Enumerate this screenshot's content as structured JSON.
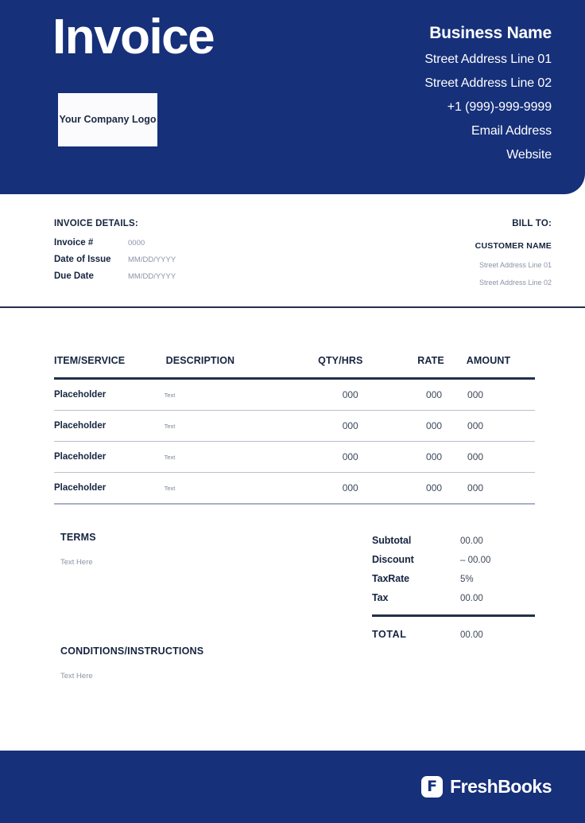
{
  "theme": {
    "brand_blue": "#16307a",
    "ink": "#16243f",
    "muted": "#8a93a6"
  },
  "header": {
    "title": "Invoice",
    "logo_placeholder": "Your Company Logo",
    "business": {
      "name": "Business Name",
      "lines": [
        "Street Address Line 01",
        "Street Address Line 02",
        "+1 (999)-999-9999",
        "Email Address",
        "Website"
      ]
    }
  },
  "invoice_details": {
    "title": "INVOICE DETAILS:",
    "rows": [
      {
        "label": "Invoice #",
        "value": "0000"
      },
      {
        "label": "Date of Issue",
        "value": "MM/DD/YYYY"
      },
      {
        "label": "Due Date",
        "value": "MM/DD/YYYY"
      }
    ]
  },
  "bill_to": {
    "title": "BILL TO:",
    "customer_name": "CUSTOMER NAME",
    "lines": [
      "Street Address Line 01",
      "Street Address Line 02"
    ]
  },
  "line_items": {
    "columns": [
      "ITEM/SERVICE",
      "DESCRIPTION",
      "QTY/HRS",
      "RATE",
      "AMOUNT"
    ],
    "rows": [
      {
        "item": "Placeholder",
        "description": "Text",
        "qty": "000",
        "rate": "000",
        "amount": "000"
      },
      {
        "item": "Placeholder",
        "description": "Text",
        "qty": "000",
        "rate": "000",
        "amount": "000"
      },
      {
        "item": "Placeholder",
        "description": "Text",
        "qty": "000",
        "rate": "000",
        "amount": "000"
      },
      {
        "item": "Placeholder",
        "description": "Text",
        "qty": "000",
        "rate": "000",
        "amount": "000"
      }
    ]
  },
  "terms": {
    "title": "TERMS",
    "text": "Text Here"
  },
  "conditions": {
    "title": "CONDITIONS/INSTRUCTIONS",
    "text": "Text Here"
  },
  "totals": {
    "rows": [
      {
        "label": "Subtotal",
        "value": "00.00"
      },
      {
        "label": "Discount",
        "value": "– 00.00"
      },
      {
        "label": "TaxRate",
        "value": "5%"
      },
      {
        "label": "Tax",
        "value": "00.00"
      }
    ],
    "grand": {
      "label": "TOTAL",
      "value": "00.00"
    }
  },
  "footer": {
    "logo_mark": "F",
    "logo_text": "FreshBooks"
  }
}
